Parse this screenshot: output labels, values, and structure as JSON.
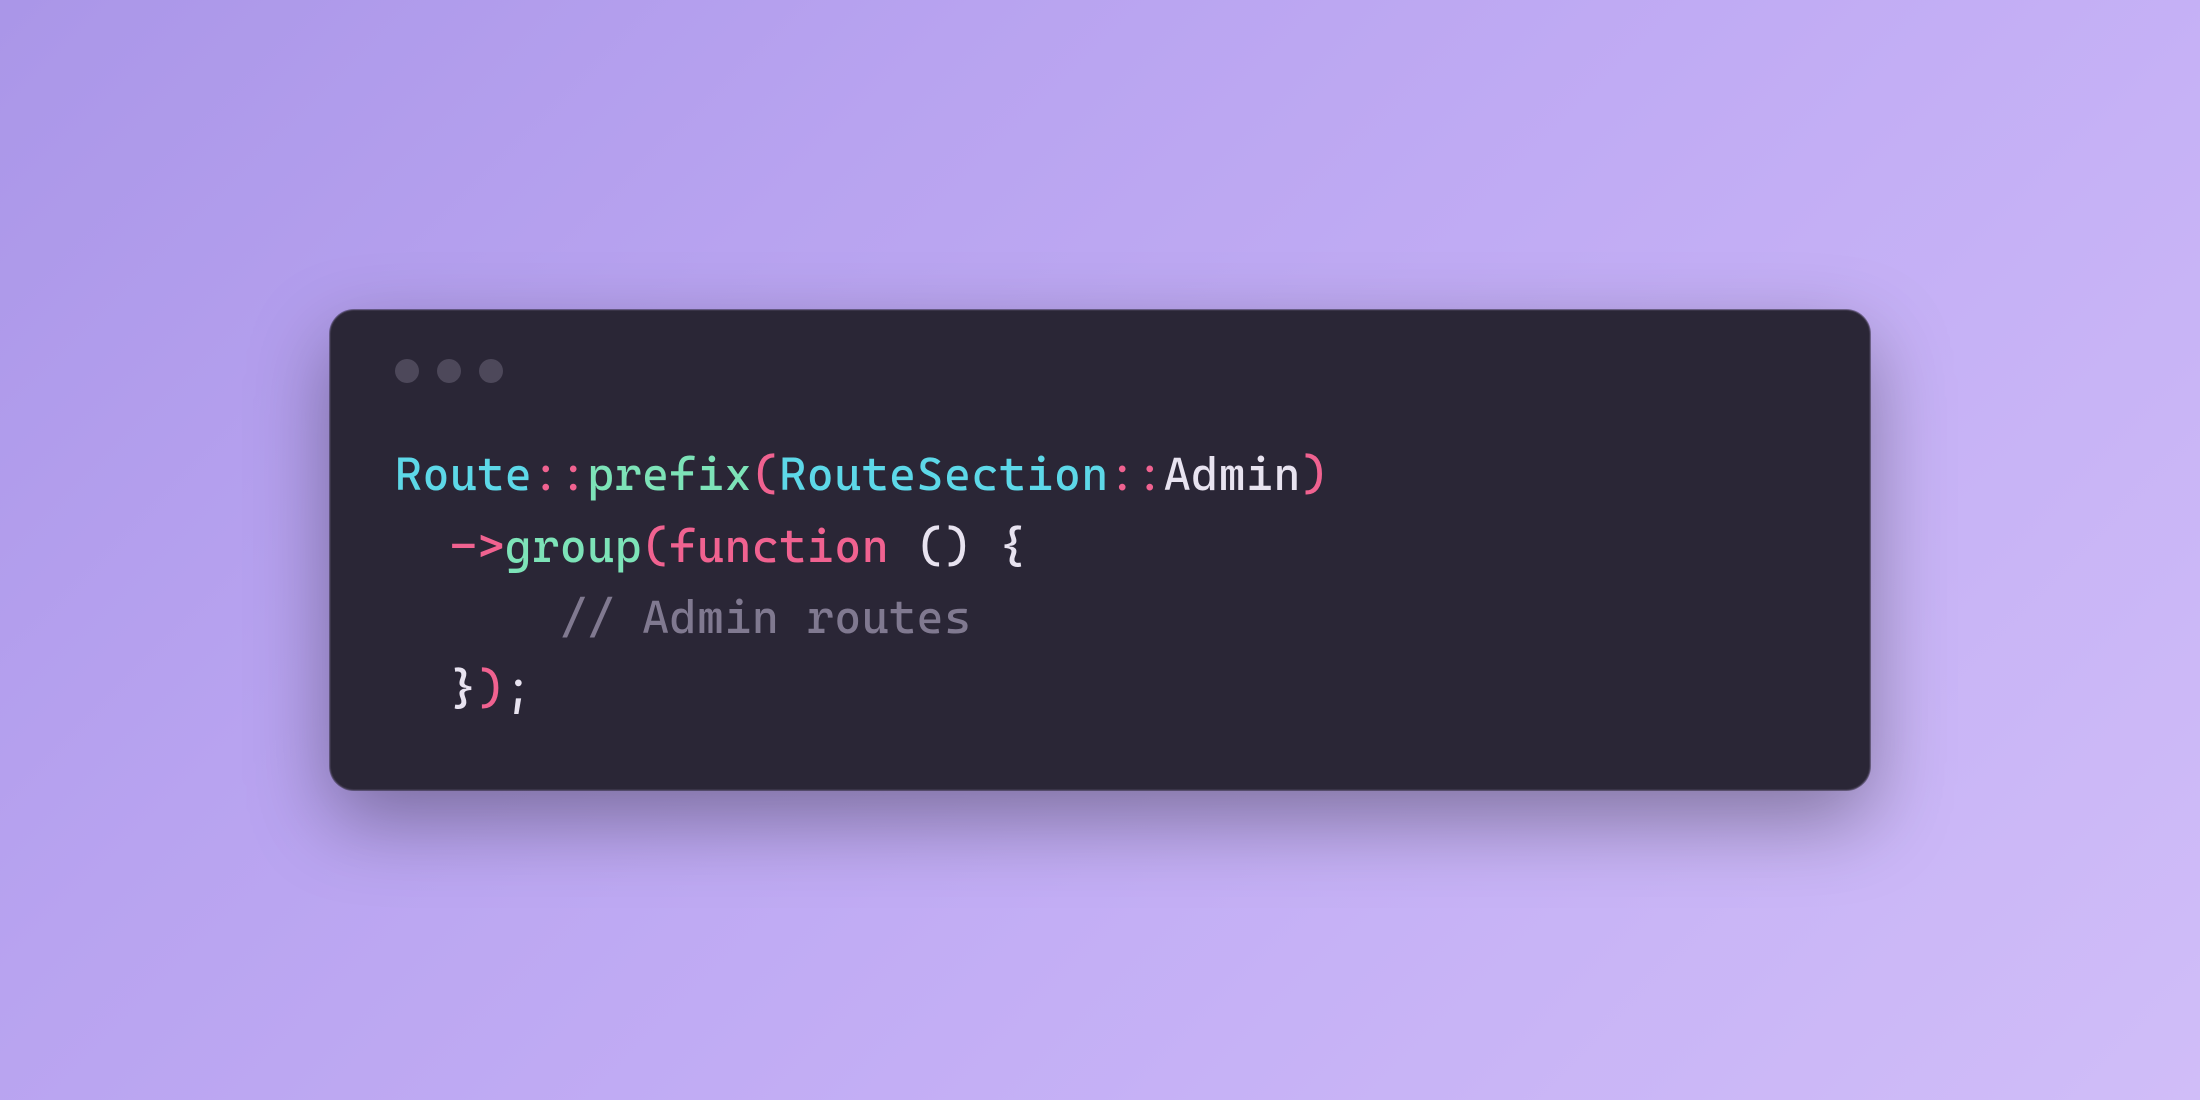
{
  "code": {
    "line1": {
      "class1": "Route",
      "scope1": "::",
      "method1": "prefix",
      "open1": "(",
      "class2": "RouteSection",
      "scope2": "::",
      "member": "Admin",
      "close1": ")"
    },
    "line2": {
      "indent": "  ",
      "arrow": "->",
      "method2": "group",
      "open2": "(",
      "keyword": "function",
      "space": " ",
      "parens": "()",
      "space2": " ",
      "brace_open": "{"
    },
    "line3": {
      "indent": "      ",
      "comment": "// Admin routes"
    },
    "line4": {
      "indent": "  ",
      "brace_close": "}",
      "close2": ")",
      "semi": ";"
    }
  }
}
